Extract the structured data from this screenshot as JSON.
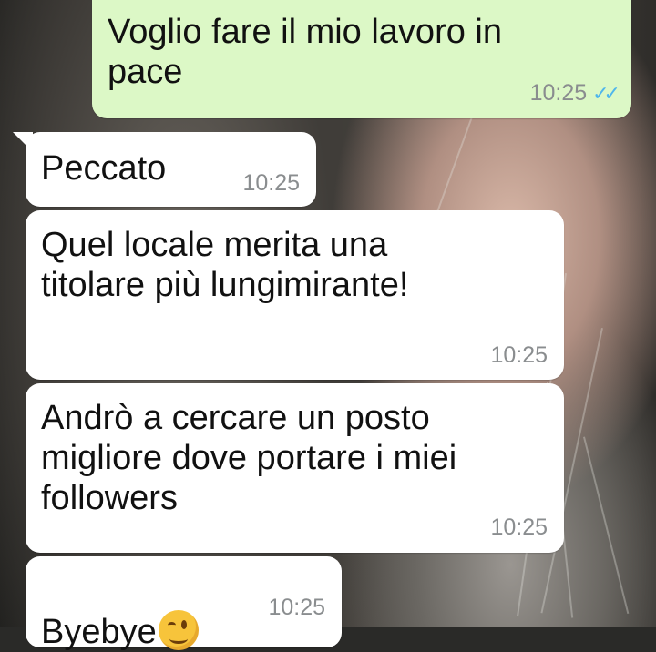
{
  "messages": [
    {
      "direction": "out",
      "text": "Voglio fare il mio lavoro in\npace",
      "time": "10:25",
      "status_icon": "double-check-icon",
      "status_color": "#4fb6ec"
    },
    {
      "direction": "in",
      "text": "Peccato",
      "time": "10:25"
    },
    {
      "direction": "in",
      "text": "Quel locale merita una\ntitolare più lungimirante!",
      "time": "10:25"
    },
    {
      "direction": "in",
      "text": "Andrò a cercare un posto\nmigliore dove portare i miei\nfollowers",
      "time": "10:25"
    },
    {
      "direction": "in",
      "text": "Byebye",
      "emoji": "winking-face-icon",
      "time": "10:25"
    }
  ],
  "colors": {
    "incoming_bubble": "#ffffff",
    "outgoing_bubble": "#dcf8c6",
    "timestamp": "#8a8d8f",
    "read_ticks": "#4fb6ec"
  }
}
